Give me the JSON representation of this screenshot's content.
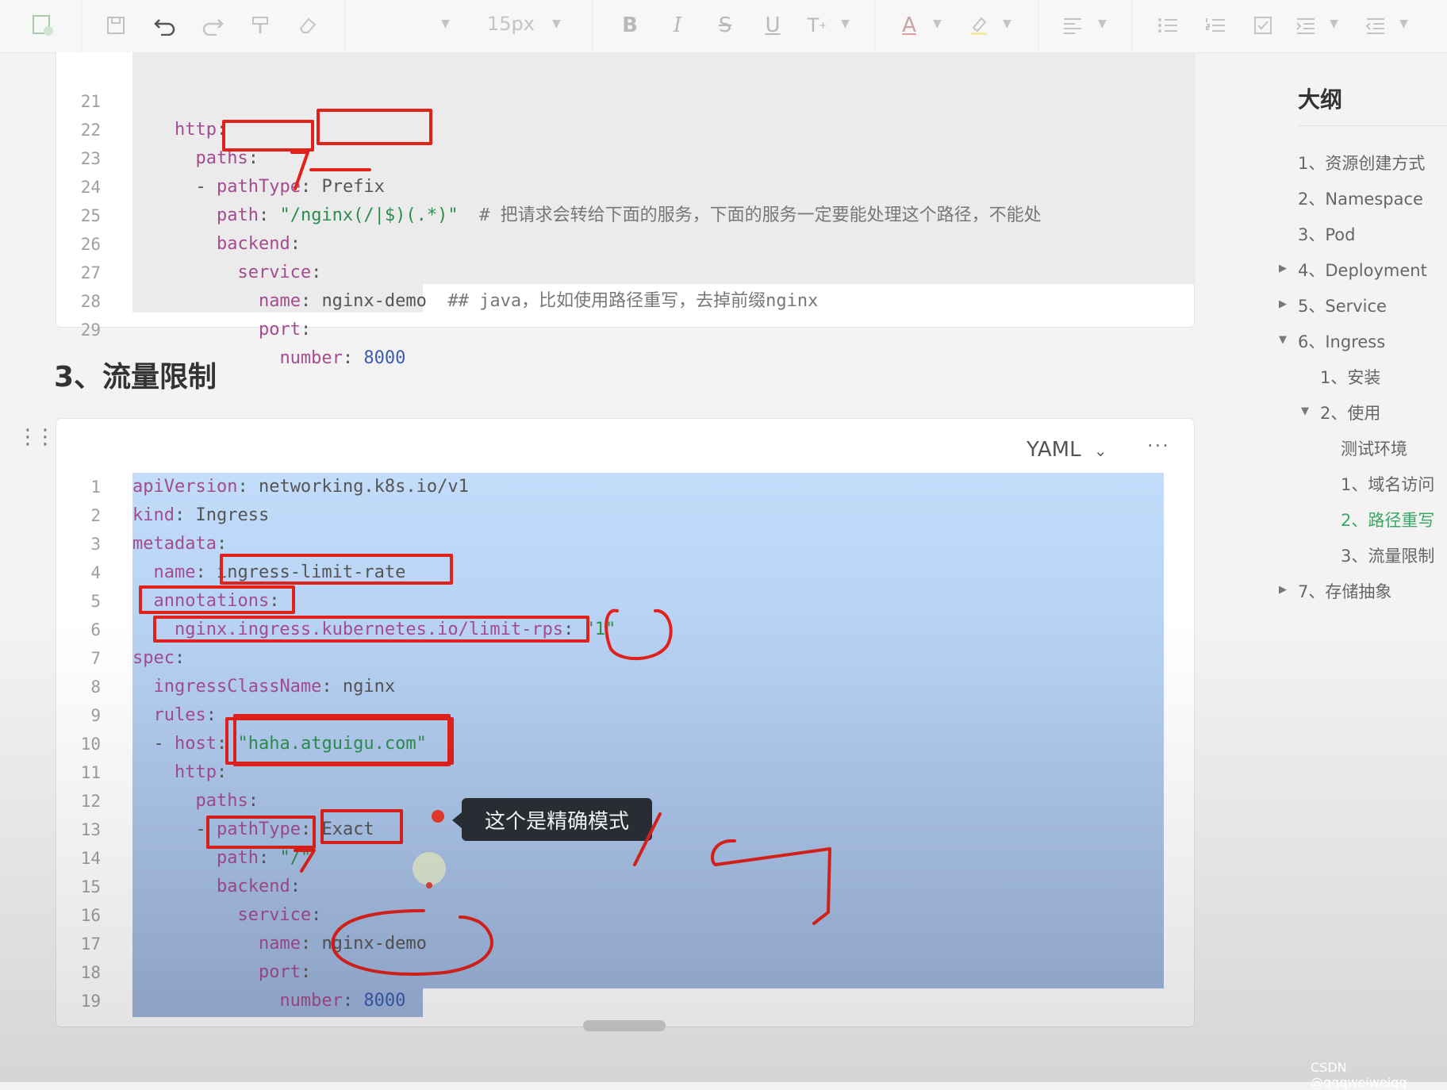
{
  "toolbar": {
    "font_size": "15px",
    "icons": [
      "new-doc-icon",
      "save-icon",
      "undo-icon",
      "redo-icon",
      "format-painter-icon",
      "eraser-icon",
      "bold-icon",
      "italic-icon",
      "strikethrough-icon",
      "underline-icon",
      "superscript-icon",
      "font-color-icon",
      "highlight-icon",
      "align-icon",
      "bullet-list-icon",
      "numbered-list-icon",
      "checklist-icon",
      "indent-icon",
      "outdent-icon"
    ]
  },
  "code_block_1": {
    "lines": [
      {
        "n": "21",
        "t": "    http:"
      },
      {
        "n": "22",
        "t": "      paths:"
      },
      {
        "n": "23",
        "t": "      - pathType: Prefix"
      },
      {
        "n": "24",
        "t": "        path: \"/nginx(/|$)(.*)\"  # 把请求会转给下面的服务，下面的服务一定要能处理这个路径，不能处理"
      },
      {
        "n": "25",
        "t": "        backend:"
      },
      {
        "n": "26",
        "t": "          service:"
      },
      {
        "n": "27",
        "t": "            name: nginx-demo  ## java，比如使用路径重写，去掉前缀nginx"
      },
      {
        "n": "28",
        "t": "            port:"
      },
      {
        "n": "29",
        "t": "              number: 8000"
      }
    ]
  },
  "heading": "3、流量限制",
  "code_block_2": {
    "language": "YAML",
    "more": "···",
    "lines": [
      {
        "n": "1",
        "t": "apiVersion: networking.k8s.io/v1"
      },
      {
        "n": "2",
        "t": "kind: Ingress"
      },
      {
        "n": "3",
        "t": "metadata:"
      },
      {
        "n": "4",
        "t": "  name: ingress-limit-rate"
      },
      {
        "n": "5",
        "t": "  annotations:"
      },
      {
        "n": "6",
        "t": "    nginx.ingress.kubernetes.io/limit-rps: \"1\""
      },
      {
        "n": "7",
        "t": "spec:"
      },
      {
        "n": "8",
        "t": "  ingressClassName: nginx"
      },
      {
        "n": "9",
        "t": "  rules:"
      },
      {
        "n": "10",
        "t": "  - host: \"haha.atguigu.com\""
      },
      {
        "n": "11",
        "t": "    http:"
      },
      {
        "n": "12",
        "t": "      paths:"
      },
      {
        "n": "13",
        "t": "      - pathType: Exact"
      },
      {
        "n": "14",
        "t": "        path: \"/\""
      },
      {
        "n": "15",
        "t": "        backend:"
      },
      {
        "n": "16",
        "t": "          service:"
      },
      {
        "n": "17",
        "t": "            name: nginx-demo"
      },
      {
        "n": "18",
        "t": "            port:"
      },
      {
        "n": "19",
        "t": "              number: 8000"
      }
    ]
  },
  "tooltip": "这个是精确模式",
  "outline": {
    "title": "大纲",
    "items": [
      {
        "label": "1、资源创建方式",
        "level": 0,
        "arrow": "",
        "active": false
      },
      {
        "label": "2、Namespace",
        "level": 0,
        "arrow": "",
        "active": false
      },
      {
        "label": "3、Pod",
        "level": 0,
        "arrow": "",
        "active": false
      },
      {
        "label": "4、Deployment",
        "level": 0,
        "arrow": "right",
        "active": false
      },
      {
        "label": "5、Service",
        "level": 0,
        "arrow": "right",
        "active": false
      },
      {
        "label": "6、Ingress",
        "level": 0,
        "arrow": "down",
        "active": false
      },
      {
        "label": "1、安装",
        "level": 1,
        "arrow": "",
        "active": false
      },
      {
        "label": "2、使用",
        "level": 1,
        "arrow": "down",
        "active": false
      },
      {
        "label": "测试环境",
        "level": 2,
        "arrow": "",
        "active": false
      },
      {
        "label": "1、域名访问",
        "level": 2,
        "arrow": "",
        "active": false
      },
      {
        "label": "2、路径重写",
        "level": 2,
        "arrow": "",
        "active": true
      },
      {
        "label": "3、流量限制",
        "level": 2,
        "arrow": "",
        "active": false
      },
      {
        "label": "7、存储抽象",
        "level": 0,
        "arrow": "right",
        "active": false
      }
    ]
  },
  "watermark": "CSDN @qqqweiweiqq",
  "colors": {
    "key": "#a34c8f",
    "string": "#2c8e4e",
    "number": "#3b5bb0",
    "active": "#3aa864",
    "annotation": "#e0221b"
  }
}
